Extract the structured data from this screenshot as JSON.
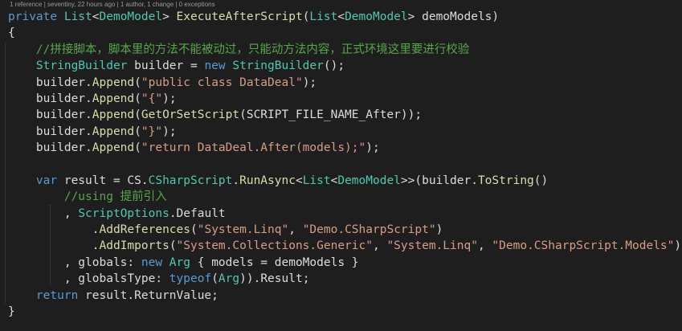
{
  "codelens": "1 reference | seventiny, 22 hours ago | 1 author, 1 change | 0 exceptions",
  "lines": [
    [
      [
        "kw",
        "private "
      ],
      [
        "ty",
        "List"
      ],
      [
        "pl",
        "<"
      ],
      [
        "ty",
        "DemoModel"
      ],
      [
        "pl",
        "> "
      ],
      [
        "fn",
        "ExecuteAfterScript"
      ],
      [
        "pl",
        "("
      ],
      [
        "ty",
        "List"
      ],
      [
        "pl",
        "<"
      ],
      [
        "ty",
        "DemoModel"
      ],
      [
        "pl",
        "> demoModels)"
      ]
    ],
    [
      [
        "pl",
        "{"
      ]
    ],
    [
      [
        "pl",
        "    "
      ],
      [
        "cm",
        "//拼接脚本，脚本里的方法不能被动过，只能动方法内容，正式环境这里要进行校验"
      ]
    ],
    [
      [
        "pl",
        "    "
      ],
      [
        "ty",
        "StringBuilder"
      ],
      [
        "pl",
        " builder = "
      ],
      [
        "kw",
        "new "
      ],
      [
        "ty",
        "StringBuilder"
      ],
      [
        "pl",
        "();"
      ]
    ],
    [
      [
        "pl",
        "    builder."
      ],
      [
        "fn",
        "Append"
      ],
      [
        "pl",
        "("
      ],
      [
        "str",
        "\"public class DataDeal\""
      ],
      [
        "pl",
        ");"
      ]
    ],
    [
      [
        "pl",
        "    builder."
      ],
      [
        "fn",
        "Append"
      ],
      [
        "pl",
        "("
      ],
      [
        "str",
        "\"{\""
      ],
      [
        "pl",
        ");"
      ]
    ],
    [
      [
        "pl",
        "    builder."
      ],
      [
        "fn",
        "Append"
      ],
      [
        "pl",
        "("
      ],
      [
        "fn",
        "GetOrSetScript"
      ],
      [
        "pl",
        "(SCRIPT_FILE_NAME_After));"
      ]
    ],
    [
      [
        "pl",
        "    builder."
      ],
      [
        "fn",
        "Append"
      ],
      [
        "pl",
        "("
      ],
      [
        "str",
        "\"}\""
      ],
      [
        "pl",
        ");"
      ]
    ],
    [
      [
        "pl",
        "    builder."
      ],
      [
        "fn",
        "Append"
      ],
      [
        "pl",
        "("
      ],
      [
        "str",
        "\"return DataDeal.After(models);\""
      ],
      [
        "pl",
        ");"
      ]
    ],
    [
      [
        "pl",
        ""
      ]
    ],
    [
      [
        "pl",
        "    "
      ],
      [
        "kw",
        "var "
      ],
      [
        "pl",
        "result = CS."
      ],
      [
        "ty",
        "CSharpScript"
      ],
      [
        "pl",
        "."
      ],
      [
        "fn",
        "RunAsync"
      ],
      [
        "pl",
        "<"
      ],
      [
        "ty",
        "List"
      ],
      [
        "pl",
        "<"
      ],
      [
        "ty",
        "DemoModel"
      ],
      [
        "pl",
        ">>(builder."
      ],
      [
        "fn",
        "ToString"
      ],
      [
        "pl",
        "()"
      ]
    ],
    [
      [
        "pl",
        "        "
      ],
      [
        "cm",
        "//using 提前引入"
      ]
    ],
    [
      [
        "pl",
        "        , "
      ],
      [
        "ty",
        "ScriptOptions"
      ],
      [
        "pl",
        ".Default"
      ]
    ],
    [
      [
        "pl",
        "            ."
      ],
      [
        "fn",
        "AddReferences"
      ],
      [
        "pl",
        "("
      ],
      [
        "str",
        "\"System.Linq\""
      ],
      [
        "pl",
        ", "
      ],
      [
        "str",
        "\"Demo.CSharpScript\""
      ],
      [
        "pl",
        ")"
      ]
    ],
    [
      [
        "pl",
        "            ."
      ],
      [
        "fn",
        "AddImports"
      ],
      [
        "pl",
        "("
      ],
      [
        "str",
        "\"System.Collections.Generic\""
      ],
      [
        "pl",
        ", "
      ],
      [
        "str",
        "\"System.Linq\""
      ],
      [
        "pl",
        ", "
      ],
      [
        "str",
        "\"Demo.CSharpScript.Models\""
      ],
      [
        "pl",
        ")"
      ]
    ],
    [
      [
        "pl",
        "        , globals: "
      ],
      [
        "kw",
        "new "
      ],
      [
        "ty",
        "Arg"
      ],
      [
        "pl",
        " { models = demoModels }"
      ]
    ],
    [
      [
        "pl",
        "        , globalsType: "
      ],
      [
        "kw",
        "typeof"
      ],
      [
        "pl",
        "("
      ],
      [
        "ty",
        "Arg"
      ],
      [
        "pl",
        ")).Result;"
      ]
    ],
    [
      [
        "pl",
        "    "
      ],
      [
        "kw",
        "return "
      ],
      [
        "pl",
        "result.ReturnValue;"
      ]
    ],
    [
      [
        "pl",
        "}"
      ]
    ]
  ]
}
